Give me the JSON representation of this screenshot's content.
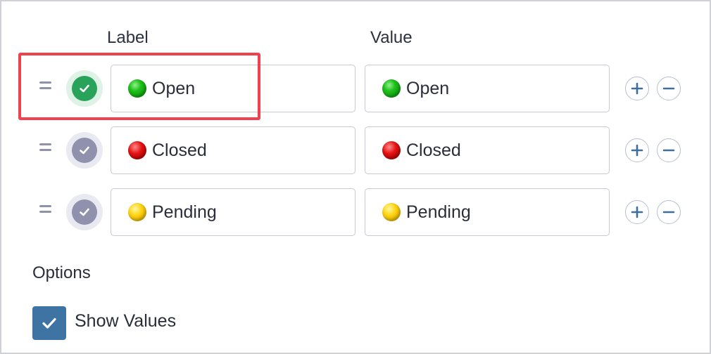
{
  "headers": {
    "label": "Label",
    "value": "Value"
  },
  "rows": [
    {
      "label": "Open",
      "value": "Open",
      "status_color": "green",
      "default_selected": true
    },
    {
      "label": "Closed",
      "value": "Closed",
      "status_color": "red",
      "default_selected": false
    },
    {
      "label": "Pending",
      "value": "Pending",
      "status_color": "yellow",
      "default_selected": false
    }
  ],
  "icons": {
    "drag": "drag-handle-icon",
    "check": "check-icon",
    "add": "plus-icon",
    "remove": "minus-icon",
    "status": "status-ball-icon"
  },
  "options": {
    "title": "Options",
    "show_values": {
      "label": "Show Values",
      "checked": true
    }
  },
  "colors": {
    "selected": "#2aa35a",
    "unselected": "#8f91ad",
    "checkbox": "#3e74a4",
    "highlight": "#f0414f"
  }
}
